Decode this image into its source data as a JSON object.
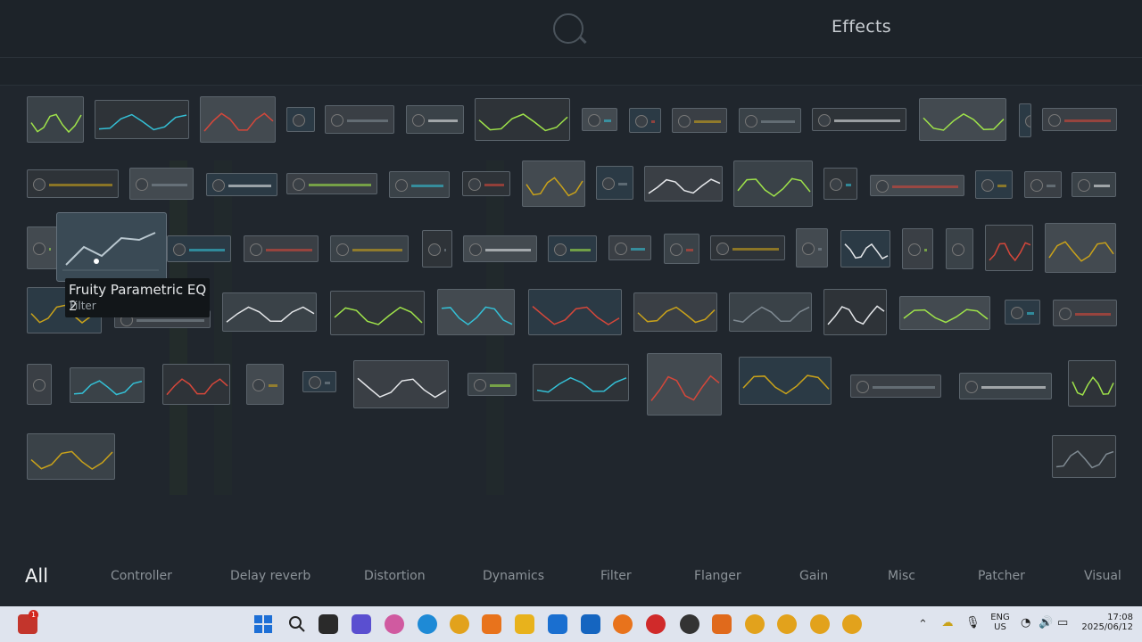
{
  "window": {
    "title": "Effects",
    "search_icon": "search-icon"
  },
  "tooltip": {
    "name": "Fruity Parametric EQ 2",
    "category": "Filter"
  },
  "categories": [
    {
      "label": "All",
      "active": true
    },
    {
      "label": "Controller"
    },
    {
      "label": "Delay reverb"
    },
    {
      "label": "Distortion"
    },
    {
      "label": "Dynamics"
    },
    {
      "label": "Filter"
    },
    {
      "label": "Flanger"
    },
    {
      "label": "Gain"
    },
    {
      "label": "Misc"
    },
    {
      "label": "Patcher"
    },
    {
      "label": "Visual"
    }
  ],
  "taskbar": {
    "language": "ENG",
    "region": "US",
    "time": "17:08",
    "date": "2025/06/12",
    "notification_badge": "1",
    "icons": [
      "start-icon",
      "search-icon",
      "file-explorer-icon",
      "chat-icon",
      "copilot-icon",
      "edge-icon",
      "chrome-icon",
      "vlc-icon",
      "folder-icon",
      "store-icon",
      "outlook-icon",
      "fl-studio-icon",
      "app-red-icon",
      "app-dark-icon",
      "app-check-icon",
      "chrome-icon",
      "chrome-icon",
      "chrome-icon",
      "chrome-icon"
    ]
  },
  "colors": {
    "accent_green": "#9fe34a",
    "accent_teal": "#34c0d6",
    "taskbar_bg": "#dfe4ee"
  }
}
